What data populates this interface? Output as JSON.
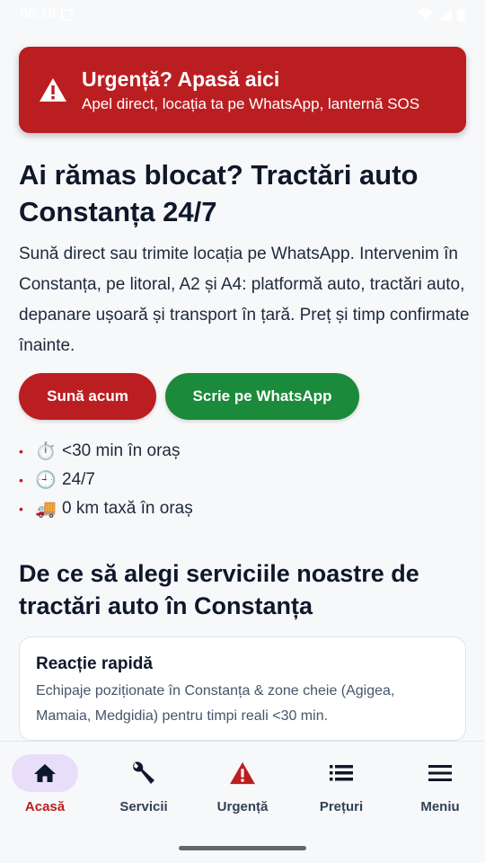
{
  "status_bar": {
    "time": "06:18"
  },
  "urgent": {
    "title": "Urgență? Apasă aici",
    "subtitle": "Apel direct, locația ta pe WhatsApp, lanternă SOS",
    "icon": "warning-icon",
    "color": "#bb1e21"
  },
  "hero": {
    "title": "Ai rămas blocat? Tractări auto Constanța 24/7",
    "description": "Sună direct sau trimite locația pe WhatsApp. Intervenim în Constanța, pe litoral, A2 și A4: platformă auto, tractări auto, depanare ușoară și transport în țară. Preț și timp confirmate înainte.",
    "call_label": "Sună acum",
    "whatsapp_label": "Scrie pe WhatsApp",
    "call_color": "#bb1e21",
    "whatsapp_color": "#1b8a3b"
  },
  "features": [
    {
      "emoji": "⏱️",
      "text": "<30 min în oraș"
    },
    {
      "emoji": "🕘",
      "text": "24/7"
    },
    {
      "emoji": "🚚",
      "text": "0 km taxă în oraș"
    }
  ],
  "section": {
    "title": "De ce să alegi serviciile noastre de tractări auto în Constanța"
  },
  "card": {
    "title": "Reacție rapidă",
    "text": "Echipaje poziționate în Constanța & zone cheie (Agigea, Mamaia, Medgidia) pentru timpi reali <30 min."
  },
  "nav": {
    "items": [
      {
        "label": "Acasă",
        "icon": "home-icon",
        "active": true
      },
      {
        "label": "Servicii",
        "icon": "wrench-icon",
        "active": false
      },
      {
        "label": "Urgență",
        "icon": "warning-icon",
        "active": false
      },
      {
        "label": "Prețuri",
        "icon": "list-icon",
        "active": false
      },
      {
        "label": "Meniu",
        "icon": "menu-icon",
        "active": false
      }
    ]
  }
}
